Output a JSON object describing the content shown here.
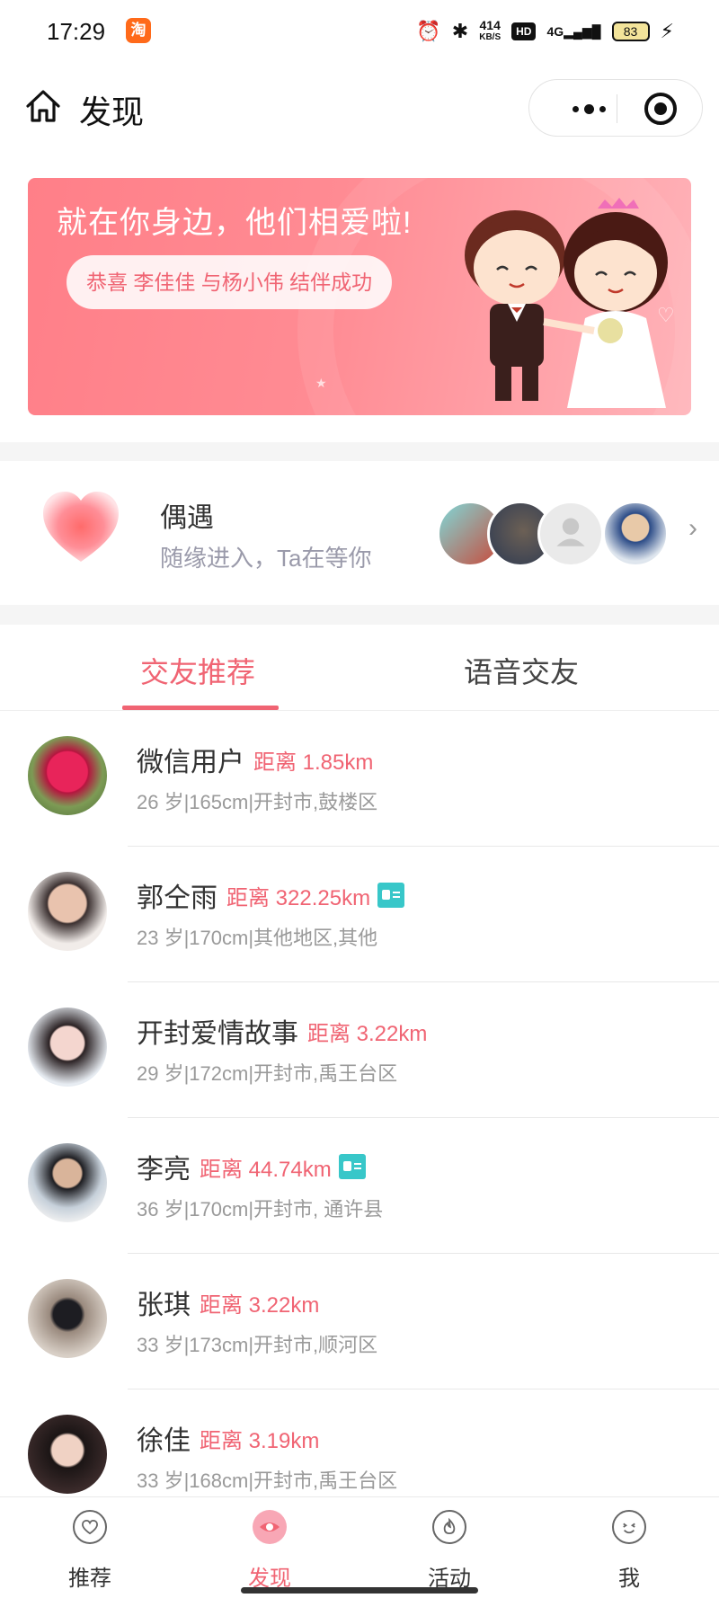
{
  "status_bar": {
    "time": "17:29",
    "app_badge": "淘",
    "net_speed": "414",
    "net_unit": "KB/S",
    "hd": "HD",
    "signal": "4G",
    "battery": "83",
    "icons": [
      "alarm-icon",
      "bluetooth-icon",
      "signal-icon",
      "charging-icon"
    ]
  },
  "navbar": {
    "title": "发现",
    "home_icon": "home-icon",
    "more_icon": "more-dots-icon",
    "close_icon": "target-circle-icon"
  },
  "banner": {
    "title": "就在你身边，他们相爱啦!",
    "congrats": "恭喜 李佳佳 与杨小伟 结伴成功",
    "illustration": "wedding-couple-illustration"
  },
  "encounter": {
    "title": "偶遇",
    "subtitle": "随缘进入，Ta在等你",
    "icon": "heart-icon",
    "avatars": [
      "avatar-cartoon-girl",
      "avatar-dark-photo",
      "avatar-placeholder",
      "avatar-man"
    ],
    "chevron": "chevron-right-icon"
  },
  "tabs": {
    "items": [
      {
        "label": "交友推荐",
        "active": true
      },
      {
        "label": "语音交友",
        "active": false
      }
    ]
  },
  "users": [
    {
      "name": "微信用户",
      "distance": "距离 1.85km",
      "info": "26 岁|165cm|开封市,鼓楼区",
      "verified": false,
      "avatar": "rose-flower-photo"
    },
    {
      "name": "郭仝雨",
      "distance": "距离 322.25km",
      "info": "23 岁|170cm|其他地区,其他",
      "verified": true,
      "avatar": "young-man-photo"
    },
    {
      "name": "开封爱情故事",
      "distance": "距离 3.22km",
      "info": "29 岁|172cm|开封市,禹王台区",
      "verified": false,
      "avatar": "woman-glasses-photo"
    },
    {
      "name": "李亮",
      "distance": "距离 44.74km",
      "info": "36 岁|170cm|开封市, 通许县",
      "verified": true,
      "avatar": "man-city-photo"
    },
    {
      "name": "张琪",
      "distance": "距离 3.22km",
      "info": "33 岁|173cm|开封市,顺河区",
      "verified": false,
      "avatar": "man-store-photo"
    },
    {
      "name": "徐佳",
      "distance": "距离 3.19km",
      "info": "33 岁|168cm|开封市,禹王台区",
      "verified": false,
      "avatar": "woman-photo"
    }
  ],
  "tabbar": {
    "items": [
      {
        "label": "推荐",
        "icon": "heart-outline-icon",
        "active": false
      },
      {
        "label": "发现",
        "icon": "eye-icon",
        "active": true
      },
      {
        "label": "活动",
        "icon": "flame-icon",
        "active": false
      },
      {
        "label": "我",
        "icon": "smile-face-icon",
        "active": false
      }
    ]
  },
  "colors": {
    "accent": "#f06473",
    "banner_start": "#ff7f88",
    "banner_end": "#ffb3b9",
    "verified_badge": "#38c7c9"
  }
}
